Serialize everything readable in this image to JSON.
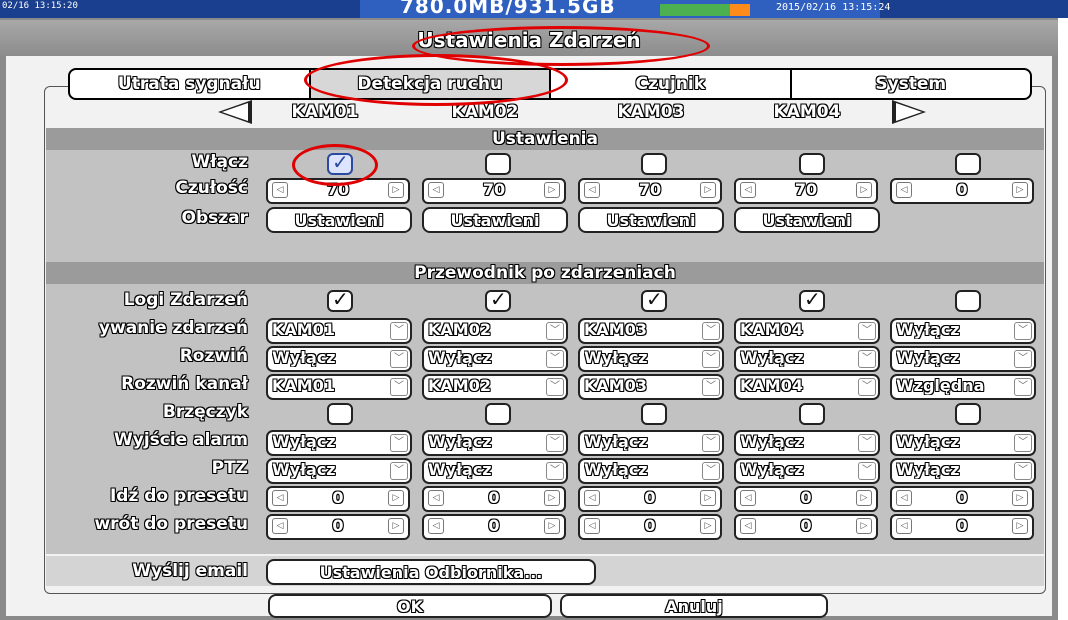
{
  "statusbar": {
    "left_time": "02/16 13:15:20",
    "hdd_usage": "780.0MB/931.5GB",
    "datetime": "2015/02/16 13:15:24"
  },
  "window": {
    "title": "Ustawienia Zdarzeń"
  },
  "tabs": [
    "Utrata sygnału",
    "Detekcja ruchu",
    "Czujnik",
    "System"
  ],
  "active_tab": "Detekcja ruchu",
  "cameras": [
    "KAM01",
    "KAM02",
    "KAM03",
    "KAM04"
  ],
  "settings": {
    "header": "Ustawienia",
    "enable_label": "Włącz",
    "enable": [
      true,
      false,
      false,
      false,
      false
    ],
    "sensitivity_label": "Czułość",
    "sensitivity": [
      "70",
      "70",
      "70",
      "70",
      "0"
    ],
    "area_label": "Obszar",
    "area_button": "Ustawieni"
  },
  "guide": {
    "header": "Przewodnik po zdarzeniach",
    "log_label": "Logi Zdarzeń",
    "log": [
      true,
      true,
      true,
      true,
      false
    ],
    "record_label": "ywanie zdarzeń",
    "record": [
      "KAM01",
      "KAM02",
      "KAM03",
      "KAM04",
      "Wyłącz"
    ],
    "expand_label": "Rozwiń",
    "expand": [
      "Wyłącz",
      "Wyłącz",
      "Wyłącz",
      "Wyłącz",
      "Wyłącz"
    ],
    "expand_channel_label": "Rozwiń kanał",
    "expand_channel": [
      "KAM01",
      "KAM02",
      "KAM03",
      "KAM04",
      "Względna"
    ],
    "buzzer_label": "Brzęczyk",
    "buzzer": [
      false,
      false,
      false,
      false,
      false
    ],
    "alarm_label": "Wyjście alarm",
    "alarm": [
      "Wyłącz",
      "Wyłącz",
      "Wyłącz",
      "Wyłącz",
      "Wyłącz"
    ],
    "ptz_label": "PTZ",
    "ptz": [
      "Wyłącz",
      "Wyłącz",
      "Wyłącz",
      "Wyłącz",
      "Wyłącz"
    ],
    "goto_preset_label": "Idź do presetu",
    "goto_preset": [
      "0",
      "0",
      "0",
      "0",
      "0"
    ],
    "return_preset_label": "wrót do presetu",
    "return_preset": [
      "0",
      "0",
      "0",
      "0",
      "0"
    ]
  },
  "email": {
    "label": "Wyślij email",
    "button": "Ustawienia Odbiornika..."
  },
  "footer": {
    "ok": "OK",
    "cancel": "Anuluj"
  },
  "colors": {
    "highlight_ellipse": "#e00000",
    "checked_blue": "#2a4aa0"
  }
}
